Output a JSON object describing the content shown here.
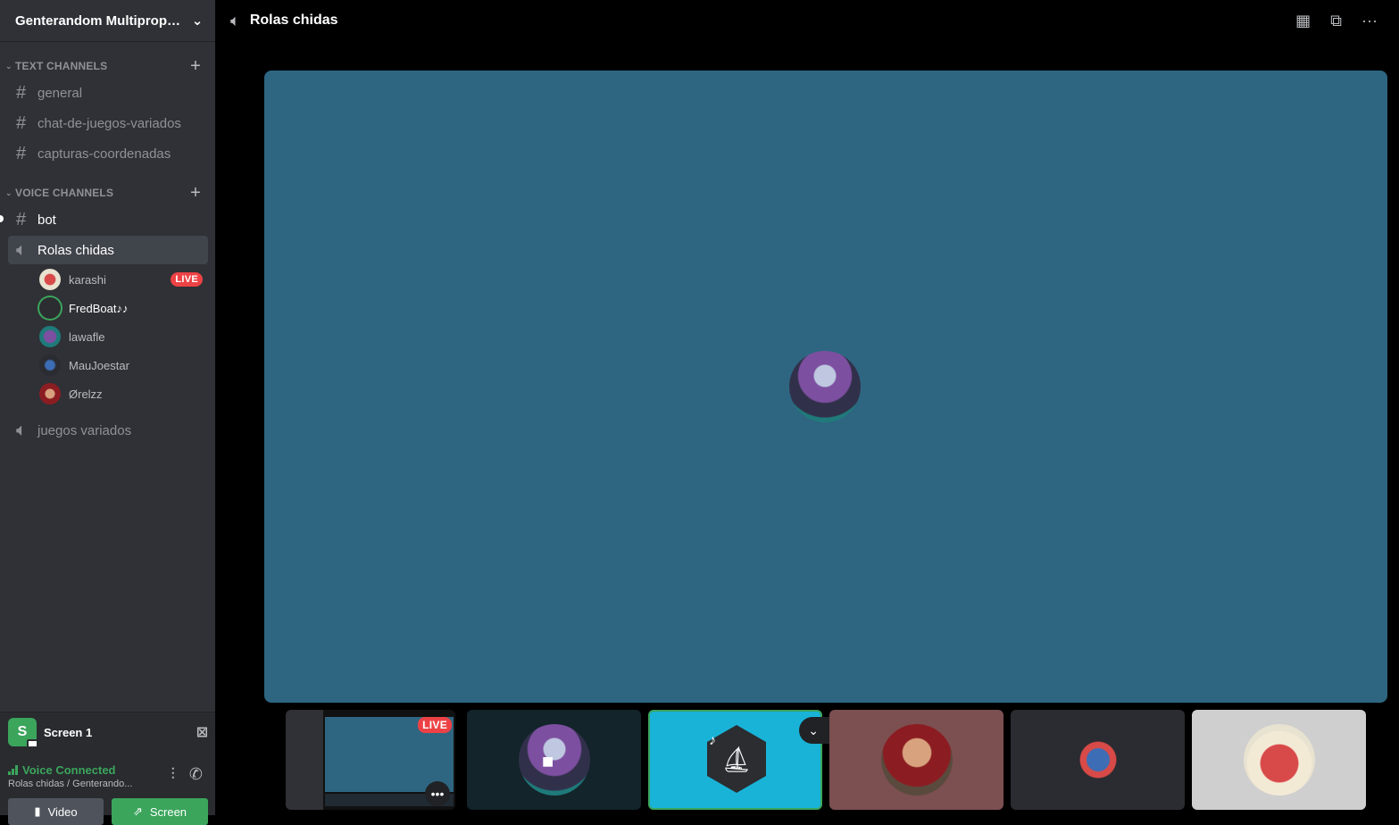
{
  "guild": {
    "name": "Genterandom Multiprop…",
    "chevron_icon": "chevron-down-icon"
  },
  "text_channels": {
    "header": "TEXT CHANNELS",
    "items": [
      {
        "name": "general",
        "icon": "hash-icon"
      },
      {
        "name": "chat-de-juegos-variados",
        "icon": "hash-icon"
      },
      {
        "name": "capturas-coordenadas",
        "icon": "hash-icon"
      }
    ]
  },
  "voice_channels": {
    "header": "VOICE CHANNELS",
    "items": [
      {
        "name": "bot",
        "icon": "hash-icon",
        "unread": true
      },
      {
        "name": "Rolas chidas",
        "icon": "speaker-icon",
        "active": true
      },
      {
        "name": "juegos variados",
        "icon": "speaker-icon"
      }
    ],
    "members": [
      {
        "name": "karashi",
        "badge": "LIVE"
      },
      {
        "name": "FredBoat♪♪",
        "speaking": true
      },
      {
        "name": "lawafle"
      },
      {
        "name": "MauJoestar"
      },
      {
        "name": "Ørelzz"
      }
    ]
  },
  "stream_panel": {
    "screen_label": "Screen 1",
    "screen_letter": "S",
    "voice_status": "Voice Connected",
    "voice_sub": "Rolas chidas / Genterando...",
    "video_button": "Video",
    "screen_button": "Screen"
  },
  "topbar": {
    "title": "Rolas chidas"
  },
  "tiles": {
    "live_badge": "LIVE",
    "more": "•••"
  },
  "colors": {
    "accent_green": "#3ba55c",
    "live_red": "#ed4245",
    "stage_blue": "#2e6682",
    "sidebar": "#2f3136"
  }
}
